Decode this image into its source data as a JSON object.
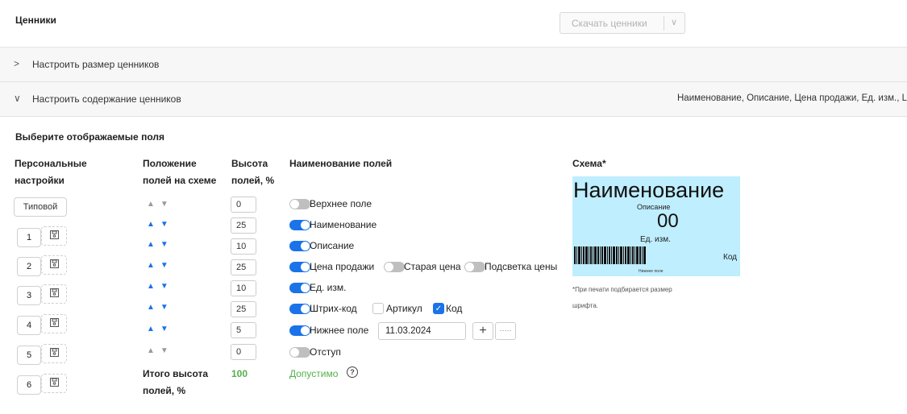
{
  "header": {
    "title": "Ценники",
    "download_label": "Скачать ценники",
    "download_chevron": "∨"
  },
  "accordions": [
    {
      "arrow": ">",
      "label": "Настроить размер ценников"
    },
    {
      "arrow": "∨",
      "label": "Настроить содержание ценников",
      "summary": "Наименование, Описание, Цена продажи, Ед. изм., L"
    }
  ],
  "section": {
    "title": "Выберите отображаемые поля"
  },
  "columns": {
    "personal": [
      "Персональные",
      "настройки"
    ],
    "position": [
      "Положение",
      "полей на схеме"
    ],
    "height": [
      "Высота",
      "полей, %"
    ],
    "names": "Наименование полей",
    "scheme": "Схема*"
  },
  "presets": {
    "default_label": "Типовой",
    "slots": [
      "1",
      "2",
      "3",
      "4",
      "5",
      "6"
    ]
  },
  "fields": [
    {
      "height": "0",
      "label": "Верхнее поле",
      "enabled": false
    },
    {
      "height": "25",
      "label": "Наименование",
      "enabled": true
    },
    {
      "height": "10",
      "label": "Описание",
      "enabled": true
    },
    {
      "height": "25",
      "label": "Цена продажи",
      "enabled": true
    },
    {
      "height": "10",
      "label": "Ед. изм.",
      "enabled": true
    },
    {
      "height": "25",
      "label": "Штрих-код",
      "enabled": true
    },
    {
      "height": "5",
      "label": "Нижнее поле",
      "enabled": true
    },
    {
      "height": "0",
      "label": "Отступ",
      "enabled": false
    }
  ],
  "extras": {
    "old_price": "Старая цена",
    "highlight_price": "Подсветка цены",
    "article": "Артикул",
    "code": "Код",
    "bottom_date": "11.03.2024",
    "plus": "+",
    "dots": "·····"
  },
  "total": {
    "label": [
      "Итого высота",
      "полей, %"
    ],
    "value": "100",
    "status": "Допустимо",
    "help_icon": "?"
  },
  "preview": {
    "name": "Наименование",
    "description": "Описание",
    "price": "00",
    "unit": "Ед. изм.",
    "code": "Код",
    "bottom": "Нижнее поле"
  },
  "notes": [
    "*При печати подбирается размер",
    "шрифта."
  ],
  "colors": {
    "accent": "#1a73e8",
    "ok_green": "#52b04a",
    "preview_bg": "#bfeefe"
  }
}
